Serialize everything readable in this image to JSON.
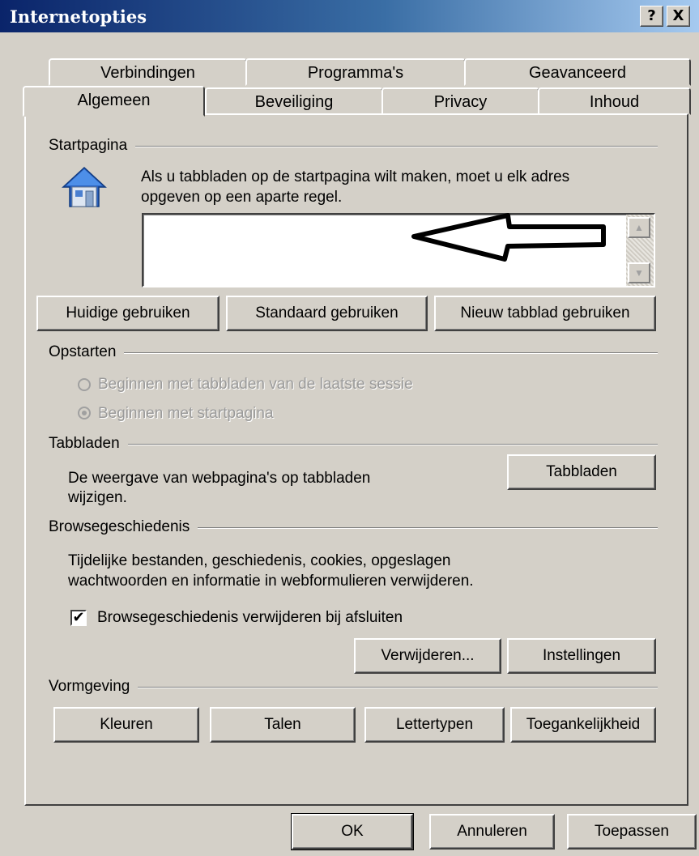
{
  "window": {
    "title": "Internetopties",
    "help_label": "?",
    "close_label": "X"
  },
  "tabs": {
    "back_row": [
      "Verbindingen",
      "Programma's",
      "Geavanceerd"
    ],
    "front_row": [
      "Algemeen",
      "Beveiliging",
      "Privacy",
      "Inhoud"
    ],
    "active": "Algemeen"
  },
  "startpagina": {
    "label": "Startpagina",
    "icon": "home-icon",
    "text_line1": "Als u tabbladen op de startpagina wilt maken, moet u elk adres",
    "text_line2": "opgeven op een aparte regel.",
    "url_value": "",
    "annotation": "arrow-pointing-left",
    "buttons": [
      "Huidige gebruiken",
      "Standaard gebruiken",
      "Nieuw tabblad gebruiken"
    ]
  },
  "opstarten": {
    "label": "Opstarten",
    "options": [
      "Beginnen met tabbladen van de laatste sessie",
      "Beginnen met startpagina"
    ],
    "selected": "Beginnen met startpagina",
    "enabled": false
  },
  "tabbladen": {
    "label": "Tabbladen",
    "text_line1": "De weergave van webpagina's op tabbladen",
    "text_line2": "wijzigen.",
    "button": "Tabbladen"
  },
  "browsegeschiedenis": {
    "label": "Browsegeschiedenis",
    "text_line1": "Tijdelijke bestanden, geschiedenis, cookies, opgeslagen",
    "text_line2": "wachtwoorden en informatie in webformulieren verwijderen.",
    "checkbox_label": "Browsegeschiedenis verwijderen bij afsluiten",
    "checkbox_checked": true,
    "buttons": [
      "Verwijderen...",
      "Instellingen"
    ]
  },
  "vormgeving": {
    "label": "Vormgeving",
    "buttons": [
      "Kleuren",
      "Talen",
      "Lettertypen",
      "Toegankelijkheid"
    ]
  },
  "footer": {
    "ok": "OK",
    "cancel": "Annuleren",
    "apply": "Toepassen"
  }
}
